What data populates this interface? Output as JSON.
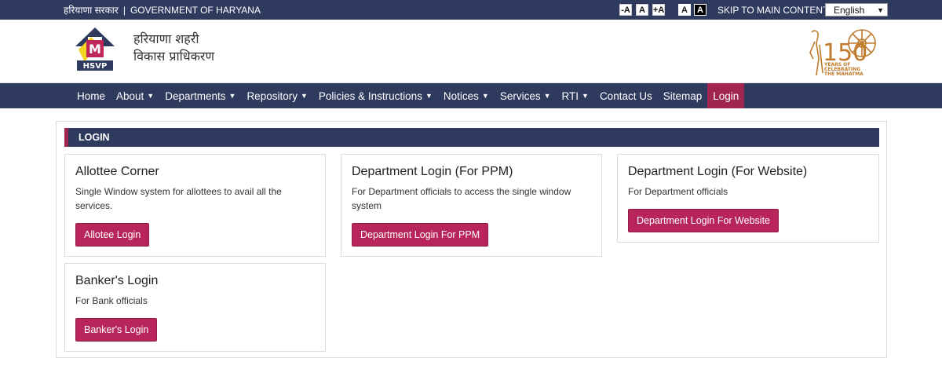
{
  "topbar": {
    "hindi_label": "हरियाणा सरकार",
    "separator": "|",
    "gov_label": "GOVERNMENT OF HARYANA",
    "font_controls": [
      "-A",
      "A",
      "+A"
    ],
    "contrast_controls": [
      "A",
      "A"
    ],
    "skip_link": "SKIP TO MAIN CONTENT",
    "language": "English"
  },
  "header": {
    "logo_abbr": "HSVP",
    "hindi_line1": "हरियाणा शहरी",
    "hindi_line2": "विकास प्राधिकरण",
    "right_logo_number": "150",
    "right_logo_line1": "YEARS OF",
    "right_logo_line2": "CELEBRATING",
    "right_logo_line3": "THE MAHATMA"
  },
  "nav": {
    "items": [
      {
        "label": "Home",
        "caret": false
      },
      {
        "label": "About",
        "caret": true
      },
      {
        "label": "Departments",
        "caret": true
      },
      {
        "label": "Repository",
        "caret": true
      },
      {
        "label": "Policies & Instructions",
        "caret": true
      },
      {
        "label": "Notices",
        "caret": true
      },
      {
        "label": "Services",
        "caret": true
      },
      {
        "label": "RTI",
        "caret": true
      },
      {
        "label": "Contact Us",
        "caret": false
      },
      {
        "label": "Sitemap",
        "caret": false
      },
      {
        "label": "Login",
        "caret": false,
        "active": true
      }
    ]
  },
  "main": {
    "section_title": "LOGIN",
    "cards": [
      {
        "title": "Allottee Corner",
        "desc": "Single Window system for allottees to avail all the services.",
        "button": "Allotee Login"
      },
      {
        "title": "Department Login (For PPM)",
        "desc": "For Department officials to access the single window system",
        "button": "Department Login For PPM"
      },
      {
        "title": "Department Login (For Website)",
        "desc": "For Department officials",
        "button": "Department Login For Website"
      },
      {
        "title": "Banker's Login",
        "desc": "For Bank officials",
        "button": "Banker's Login"
      }
    ]
  },
  "colors": {
    "navy": "#2f3a5f",
    "accent": "#a0264f",
    "button": "#b8255a",
    "logo_gold": "#c07a2c"
  }
}
